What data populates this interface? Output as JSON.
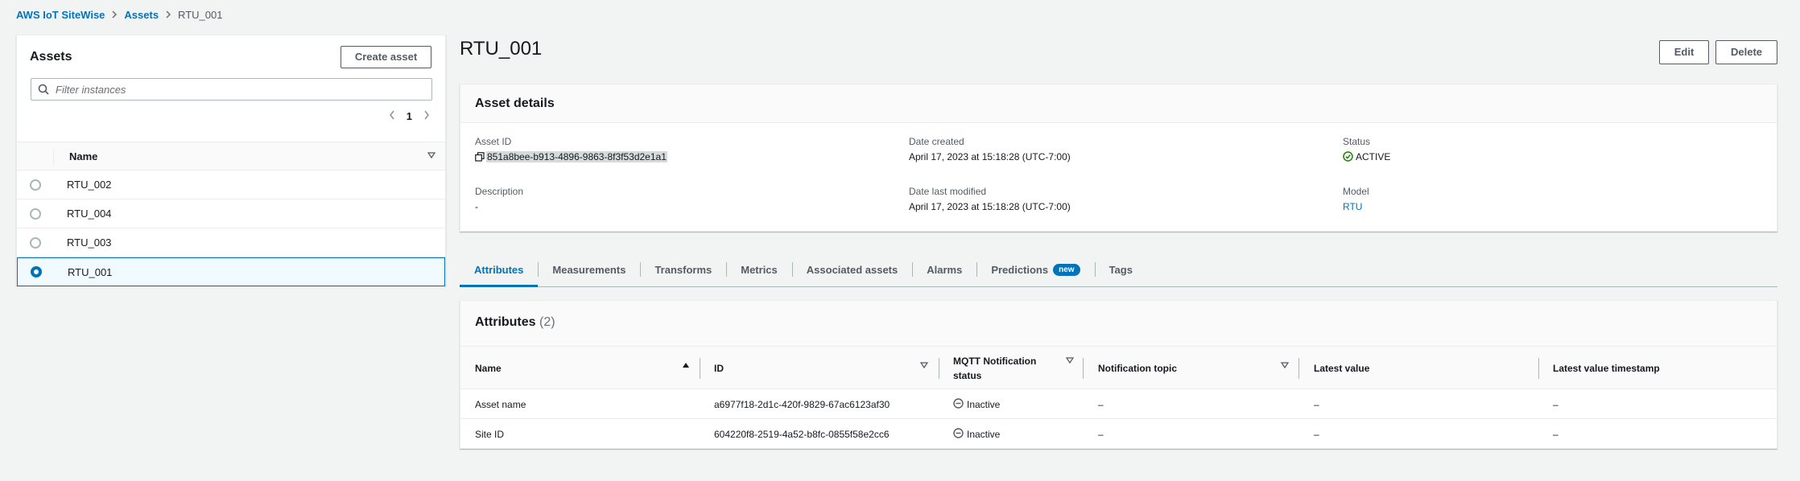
{
  "breadcrumb": {
    "items": [
      "AWS IoT SiteWise",
      "Assets"
    ],
    "current": "RTU_001"
  },
  "assets_panel": {
    "title": "Assets",
    "create_label": "Create asset",
    "search_placeholder": "Filter instances",
    "page": "1",
    "column_name": "Name",
    "rows": [
      "RTU_002",
      "RTU_004",
      "RTU_003",
      "RTU_001"
    ],
    "selected": "RTU_001"
  },
  "page": {
    "title": "RTU_001",
    "edit_label": "Edit",
    "delete_label": "Delete"
  },
  "details": {
    "title": "Asset details",
    "asset_id_label": "Asset ID",
    "asset_id": "851a8bee-b913-4896-9863-8f3f53d2e1a1",
    "description_label": "Description",
    "description": "-",
    "date_created_label": "Date created",
    "date_created": "April 17, 2023 at 15:18:28 (UTC-7:00)",
    "date_modified_label": "Date last modified",
    "date_modified": "April 17, 2023 at 15:18:28 (UTC-7:00)",
    "status_label": "Status",
    "status": "ACTIVE",
    "model_label": "Model",
    "model": "RTU"
  },
  "tabs": {
    "items": [
      "Attributes",
      "Measurements",
      "Transforms",
      "Metrics",
      "Associated assets",
      "Alarms",
      "Predictions",
      "Tags"
    ],
    "active": "Attributes",
    "predictions_badge": "new"
  },
  "attributes": {
    "title": "Attributes",
    "count": "(2)",
    "columns": {
      "name": "Name",
      "id": "ID",
      "mqtt_line1": "MQTT Notification",
      "mqtt_line2": "status",
      "topic": "Notification topic",
      "latest_value": "Latest value",
      "latest_ts": "Latest value timestamp"
    },
    "rows": [
      {
        "name": "Asset name",
        "id": "a6977f18-2d1c-420f-9829-67ac6123af30",
        "status": "Inactive",
        "topic": "–",
        "value": "–",
        "timestamp": "–"
      },
      {
        "name": "Site ID",
        "id": "604220f8-2519-4a52-b8fc-0855f58e2cc6",
        "status": "Inactive",
        "topic": "–",
        "value": "–",
        "timestamp": "–"
      }
    ]
  },
  "colors": {
    "link": "#0073bb",
    "active_status": "#1d8102",
    "background": "#f2f3f3"
  }
}
